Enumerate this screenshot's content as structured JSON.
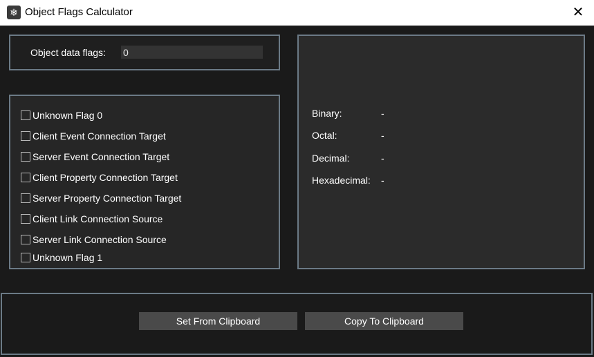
{
  "window": {
    "title": "Object Flags Calculator",
    "close_glyph": "✕",
    "icon": "snowflake-gear-icon"
  },
  "input": {
    "label": "Object data flags:",
    "value": "0"
  },
  "flags": [
    {
      "label": "Unknown Flag 0",
      "checked": false
    },
    {
      "label": "Client Event Connection Target",
      "checked": false
    },
    {
      "label": "Server Event Connection Target",
      "checked": false
    },
    {
      "label": "Client Property Connection Target",
      "checked": false
    },
    {
      "label": "Server Property Connection Target",
      "checked": false
    },
    {
      "label": "Client Link Connection Source",
      "checked": false
    },
    {
      "label": "Server Link Connection Source",
      "checked": false
    },
    {
      "label": "Unknown Flag 1",
      "checked": false
    }
  ],
  "results": {
    "binary": {
      "label": "Binary:",
      "value": "-"
    },
    "octal": {
      "label": "Octal:",
      "value": "-"
    },
    "decimal": {
      "label": "Decimal:",
      "value": "-"
    },
    "hexadecimal": {
      "label": "Hexadecimal:",
      "value": "-"
    }
  },
  "buttons": {
    "set_from_clipboard": "Set From Clipboard",
    "copy_to_clipboard": "Copy To Clipboard"
  },
  "colors": {
    "panel_border": "#6b7a86",
    "background": "#1a1a1a",
    "button_bg": "#4a4a4a"
  }
}
